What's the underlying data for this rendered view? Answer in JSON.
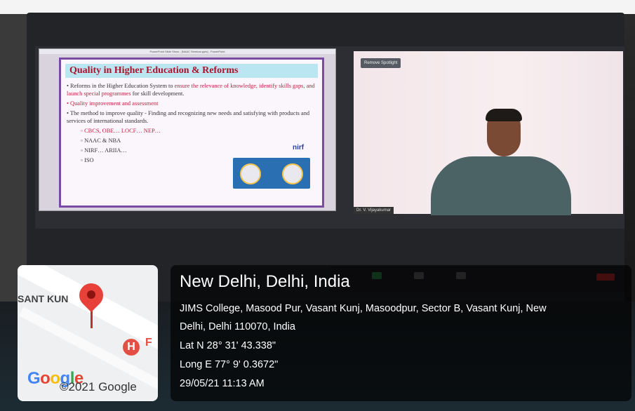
{
  "zoom": {
    "slide_window_title": "PowerPoint Slide Show - [NAAC Seminar.pptx] - PowerPoint",
    "remove_spotlight": "Remove Spotlight",
    "participant_name": "Dr. V. Vijayakumar",
    "slide": {
      "title": "Quality in Higher Education & Reforms",
      "bullet1_plain": "Reforms in the Higher Education System to ",
      "bullet1_red": "ensure the relevance of knowledge, identify skills gaps, and launch special programmes",
      "bullet1_tail": " for skill development.",
      "bullet2": "Quality improvement and assessment",
      "bullet3": "The method to improve quality - Finding and recognizing new needs and satisfying with products and services of international standards.",
      "sub1": "CBCS, OBE… LOCF… NEP…",
      "sub2": "NAAC & NBA",
      "sub3": "NIRF… ARIIA…",
      "sub4": "ISO",
      "nirf": "nirf"
    }
  },
  "map": {
    "area_label": "SANT KUN",
    "google_logo": "Google",
    "copyright": "©2021 Google",
    "hospital_letter": "H",
    "hospital_tail": "F",
    "colors": {
      "pin": "#e8413a",
      "hospital": "#e34f45"
    }
  },
  "location": {
    "title": "New Delhi, Delhi, India",
    "address_line1": "JIMS College, Masood Pur, Vasant Kunj, Masoodpur, Sector B, Vasant Kunj, New",
    "address_line2": "Delhi, Delhi 110070, India",
    "lat": "Lat N 28° 31' 43.338\"",
    "long": "Long E 77° 9' 0.3672\"",
    "datetime": "29/05/21 11:13 AM"
  }
}
